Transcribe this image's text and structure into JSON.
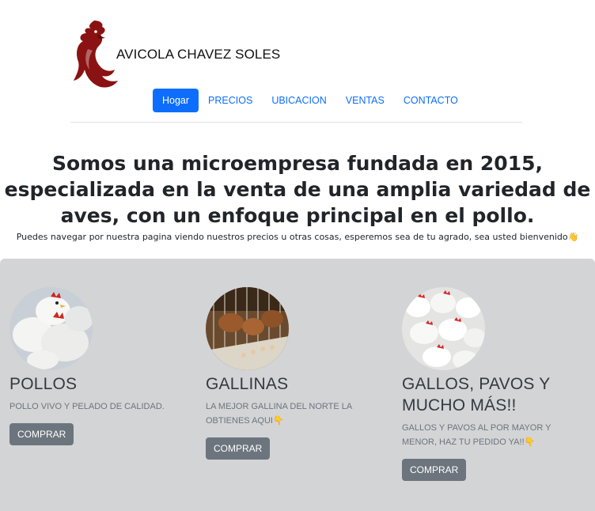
{
  "brand": {
    "name": "AVICOLA CHAVEZ SOLES",
    "logo_icon": "rooster-logo-icon"
  },
  "nav": {
    "items": [
      {
        "label": "Hogar",
        "active": true
      },
      {
        "label": "PRECIOS",
        "active": false
      },
      {
        "label": "UBICACION",
        "active": false
      },
      {
        "label": "VENTAS",
        "active": false
      },
      {
        "label": "CONTACTO",
        "active": false
      }
    ]
  },
  "hero": {
    "heading": "Somos una microempresa fundada en 2015, especializada en la venta de una amplia variedad de aves, con un enfoque principal en el pollo.",
    "subtext": "Puedes navegar por nuestra pagina viendo nuestros precios u otras cosas, esperemos sea de tu agrado, sea usted bienvenido👋"
  },
  "products": [
    {
      "title": "POLLOS",
      "description": "POLLO VIVO Y PELADO DE CALIDAD.",
      "button": "COMPRAR",
      "image": "white-chickens-photo"
    },
    {
      "title": "GALLINAS",
      "description": "LA MEJOR GALLINA DEL NORTE LA OBTIENES AQUI👇",
      "button": "COMPRAR",
      "image": "hens-in-cages-photo"
    },
    {
      "title": "GALLOS, PAVOS Y MUCHO MÁS!!",
      "description": "GALLOS Y PAVOS AL POR MAYOR Y MENOR, HAZ TU PEDIDO YA!!👇",
      "button": "COMPRAR",
      "image": "poultry-flock-photo"
    }
  ],
  "colors": {
    "primary": "#0d6efd",
    "secondary_button": "#6c757d",
    "panel_bg": "#d3d4d6",
    "logo_red": "#8b1212"
  }
}
